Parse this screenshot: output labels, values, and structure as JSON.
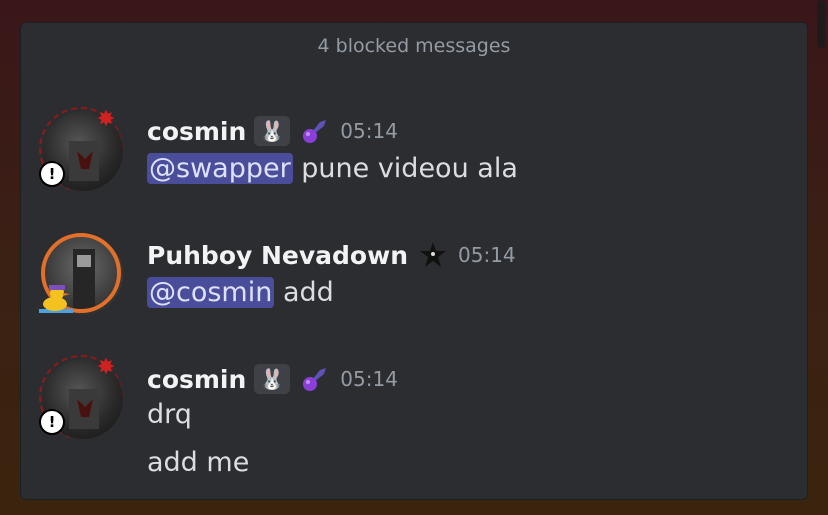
{
  "blocked_banner": "4 blocked messages",
  "messages": [
    {
      "username": "cosmin",
      "role_icon": "bunny-icon",
      "extra_icon": "comet-icon",
      "time": "05:14",
      "lines": [
        {
          "mention": "@swapper",
          "text": " pune videou ala"
        }
      ]
    },
    {
      "username": "Puhboy Nevadown",
      "extra_icon": "black-star-icon",
      "time": "05:14",
      "lines": [
        {
          "mention": "@cosmin",
          "text": " add"
        }
      ]
    },
    {
      "username": "cosmin",
      "role_icon": "bunny-icon",
      "extra_icon": "comet-icon",
      "time": "05:14",
      "lines": [
        {
          "text": "drq"
        },
        {
          "text": "add me"
        }
      ]
    }
  ],
  "colors": {
    "panel_bg": "#2b2d31",
    "mention_bg": "#4a4e9a",
    "mention_text": "#dee0fc",
    "username": "#f2f3f5",
    "timestamp": "#949ba4"
  }
}
